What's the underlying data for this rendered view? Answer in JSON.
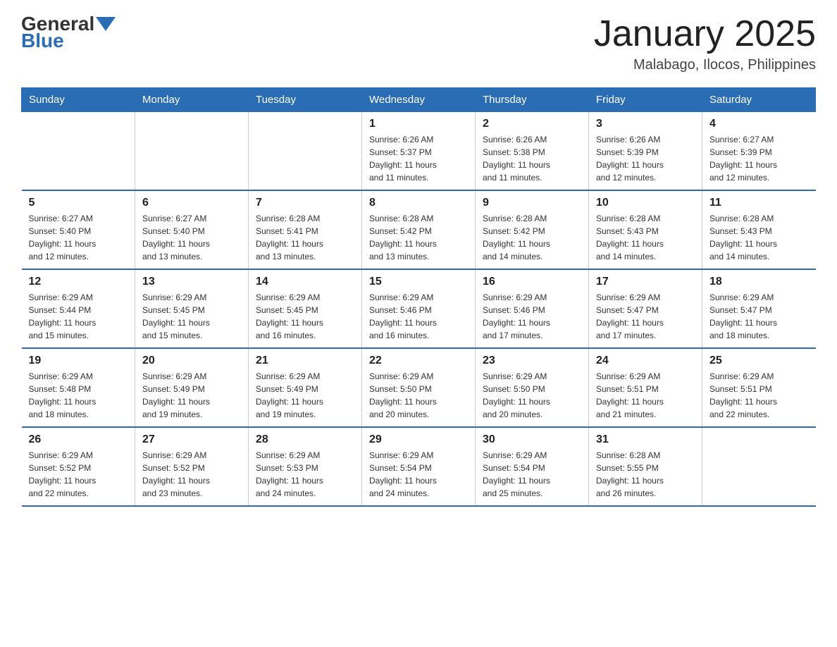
{
  "header": {
    "logo_general": "General",
    "logo_blue": "Blue",
    "month_title": "January 2025",
    "location": "Malabago, Ilocos, Philippines"
  },
  "days_of_week": [
    "Sunday",
    "Monday",
    "Tuesday",
    "Wednesday",
    "Thursday",
    "Friday",
    "Saturday"
  ],
  "weeks": [
    [
      {
        "day": "",
        "info": ""
      },
      {
        "day": "",
        "info": ""
      },
      {
        "day": "",
        "info": ""
      },
      {
        "day": "1",
        "info": "Sunrise: 6:26 AM\nSunset: 5:37 PM\nDaylight: 11 hours\nand 11 minutes."
      },
      {
        "day": "2",
        "info": "Sunrise: 6:26 AM\nSunset: 5:38 PM\nDaylight: 11 hours\nand 11 minutes."
      },
      {
        "day": "3",
        "info": "Sunrise: 6:26 AM\nSunset: 5:39 PM\nDaylight: 11 hours\nand 12 minutes."
      },
      {
        "day": "4",
        "info": "Sunrise: 6:27 AM\nSunset: 5:39 PM\nDaylight: 11 hours\nand 12 minutes."
      }
    ],
    [
      {
        "day": "5",
        "info": "Sunrise: 6:27 AM\nSunset: 5:40 PM\nDaylight: 11 hours\nand 12 minutes."
      },
      {
        "day": "6",
        "info": "Sunrise: 6:27 AM\nSunset: 5:40 PM\nDaylight: 11 hours\nand 13 minutes."
      },
      {
        "day": "7",
        "info": "Sunrise: 6:28 AM\nSunset: 5:41 PM\nDaylight: 11 hours\nand 13 minutes."
      },
      {
        "day": "8",
        "info": "Sunrise: 6:28 AM\nSunset: 5:42 PM\nDaylight: 11 hours\nand 13 minutes."
      },
      {
        "day": "9",
        "info": "Sunrise: 6:28 AM\nSunset: 5:42 PM\nDaylight: 11 hours\nand 14 minutes."
      },
      {
        "day": "10",
        "info": "Sunrise: 6:28 AM\nSunset: 5:43 PM\nDaylight: 11 hours\nand 14 minutes."
      },
      {
        "day": "11",
        "info": "Sunrise: 6:28 AM\nSunset: 5:43 PM\nDaylight: 11 hours\nand 14 minutes."
      }
    ],
    [
      {
        "day": "12",
        "info": "Sunrise: 6:29 AM\nSunset: 5:44 PM\nDaylight: 11 hours\nand 15 minutes."
      },
      {
        "day": "13",
        "info": "Sunrise: 6:29 AM\nSunset: 5:45 PM\nDaylight: 11 hours\nand 15 minutes."
      },
      {
        "day": "14",
        "info": "Sunrise: 6:29 AM\nSunset: 5:45 PM\nDaylight: 11 hours\nand 16 minutes."
      },
      {
        "day": "15",
        "info": "Sunrise: 6:29 AM\nSunset: 5:46 PM\nDaylight: 11 hours\nand 16 minutes."
      },
      {
        "day": "16",
        "info": "Sunrise: 6:29 AM\nSunset: 5:46 PM\nDaylight: 11 hours\nand 17 minutes."
      },
      {
        "day": "17",
        "info": "Sunrise: 6:29 AM\nSunset: 5:47 PM\nDaylight: 11 hours\nand 17 minutes."
      },
      {
        "day": "18",
        "info": "Sunrise: 6:29 AM\nSunset: 5:47 PM\nDaylight: 11 hours\nand 18 minutes."
      }
    ],
    [
      {
        "day": "19",
        "info": "Sunrise: 6:29 AM\nSunset: 5:48 PM\nDaylight: 11 hours\nand 18 minutes."
      },
      {
        "day": "20",
        "info": "Sunrise: 6:29 AM\nSunset: 5:49 PM\nDaylight: 11 hours\nand 19 minutes."
      },
      {
        "day": "21",
        "info": "Sunrise: 6:29 AM\nSunset: 5:49 PM\nDaylight: 11 hours\nand 19 minutes."
      },
      {
        "day": "22",
        "info": "Sunrise: 6:29 AM\nSunset: 5:50 PM\nDaylight: 11 hours\nand 20 minutes."
      },
      {
        "day": "23",
        "info": "Sunrise: 6:29 AM\nSunset: 5:50 PM\nDaylight: 11 hours\nand 20 minutes."
      },
      {
        "day": "24",
        "info": "Sunrise: 6:29 AM\nSunset: 5:51 PM\nDaylight: 11 hours\nand 21 minutes."
      },
      {
        "day": "25",
        "info": "Sunrise: 6:29 AM\nSunset: 5:51 PM\nDaylight: 11 hours\nand 22 minutes."
      }
    ],
    [
      {
        "day": "26",
        "info": "Sunrise: 6:29 AM\nSunset: 5:52 PM\nDaylight: 11 hours\nand 22 minutes."
      },
      {
        "day": "27",
        "info": "Sunrise: 6:29 AM\nSunset: 5:52 PM\nDaylight: 11 hours\nand 23 minutes."
      },
      {
        "day": "28",
        "info": "Sunrise: 6:29 AM\nSunset: 5:53 PM\nDaylight: 11 hours\nand 24 minutes."
      },
      {
        "day": "29",
        "info": "Sunrise: 6:29 AM\nSunset: 5:54 PM\nDaylight: 11 hours\nand 24 minutes."
      },
      {
        "day": "30",
        "info": "Sunrise: 6:29 AM\nSunset: 5:54 PM\nDaylight: 11 hours\nand 25 minutes."
      },
      {
        "day": "31",
        "info": "Sunrise: 6:28 AM\nSunset: 5:55 PM\nDaylight: 11 hours\nand 26 minutes."
      },
      {
        "day": "",
        "info": ""
      }
    ]
  ]
}
